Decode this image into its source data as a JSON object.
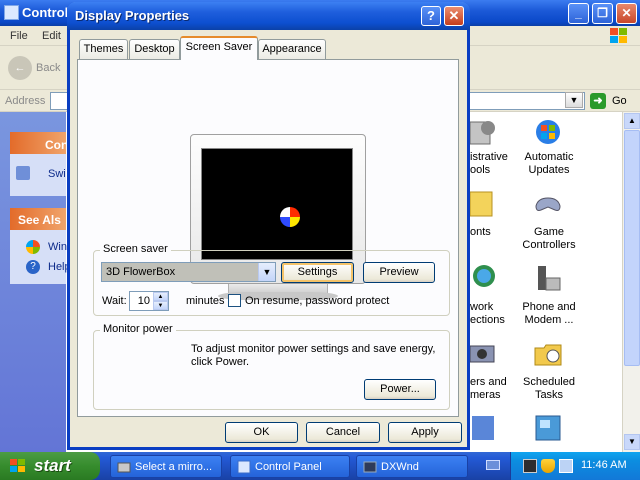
{
  "control_panel": {
    "title": "Control Panel",
    "menu": [
      "File",
      "Edit"
    ],
    "back_label": "Back",
    "address_label": "Address",
    "go_label": "Go",
    "task_panes": [
      {
        "header": "Con",
        "items": [
          "Swi"
        ]
      },
      {
        "header": "See Als",
        "items": [
          "Win",
          "Help"
        ]
      }
    ],
    "items": [
      {
        "label": "istrative\nools",
        "icon": "administrative-tools-icon"
      },
      {
        "label": "Automatic\nUpdates",
        "icon": "automatic-updates-icon"
      },
      {
        "label": "onts",
        "icon": "fonts-icon"
      },
      {
        "label": "Game\nControllers",
        "icon": "game-controllers-icon"
      },
      {
        "label": "work\nections",
        "icon": "network-connections-icon"
      },
      {
        "label": "Phone and\nModem ...",
        "icon": "phone-modem-icon"
      },
      {
        "label": "ers and\nmeras",
        "icon": "scanners-cameras-icon"
      },
      {
        "label": "Scheduled\nTasks",
        "icon": "scheduled-tasks-icon"
      }
    ]
  },
  "dialog": {
    "title": "Display Properties",
    "help_glyph": "?",
    "close_glyph": "✕",
    "tabs": [
      "Themes",
      "Desktop",
      "Screen Saver",
      "Appearance"
    ],
    "active_tab": "Screen Saver",
    "screen_saver": {
      "group_label": "Screen saver",
      "selected": "3D FlowerBox",
      "settings_button": "Settings",
      "preview_button": "Preview",
      "wait_label": "Wait:",
      "wait_value": "10",
      "minutes_label": "minutes",
      "resume_label": "On resume, password protect",
      "resume_checked": false
    },
    "monitor_power": {
      "group_label": "Monitor power",
      "text": "To adjust monitor power settings and save energy, click Power.",
      "power_button": "Power..."
    },
    "ok_button": "OK",
    "cancel_button": "Cancel",
    "apply_button": "Apply"
  },
  "taskbar": {
    "start_label": "start",
    "tasks": [
      "Select a mirro...",
      "Control Panel",
      "DXWnd"
    ],
    "clock": "11:46 AM"
  },
  "colors": {
    "title_blue": "#0b4fd0",
    "start_green": "#368c2d",
    "tray_blue": "#0c8ee0",
    "tab_accent": "#e68b2c"
  }
}
